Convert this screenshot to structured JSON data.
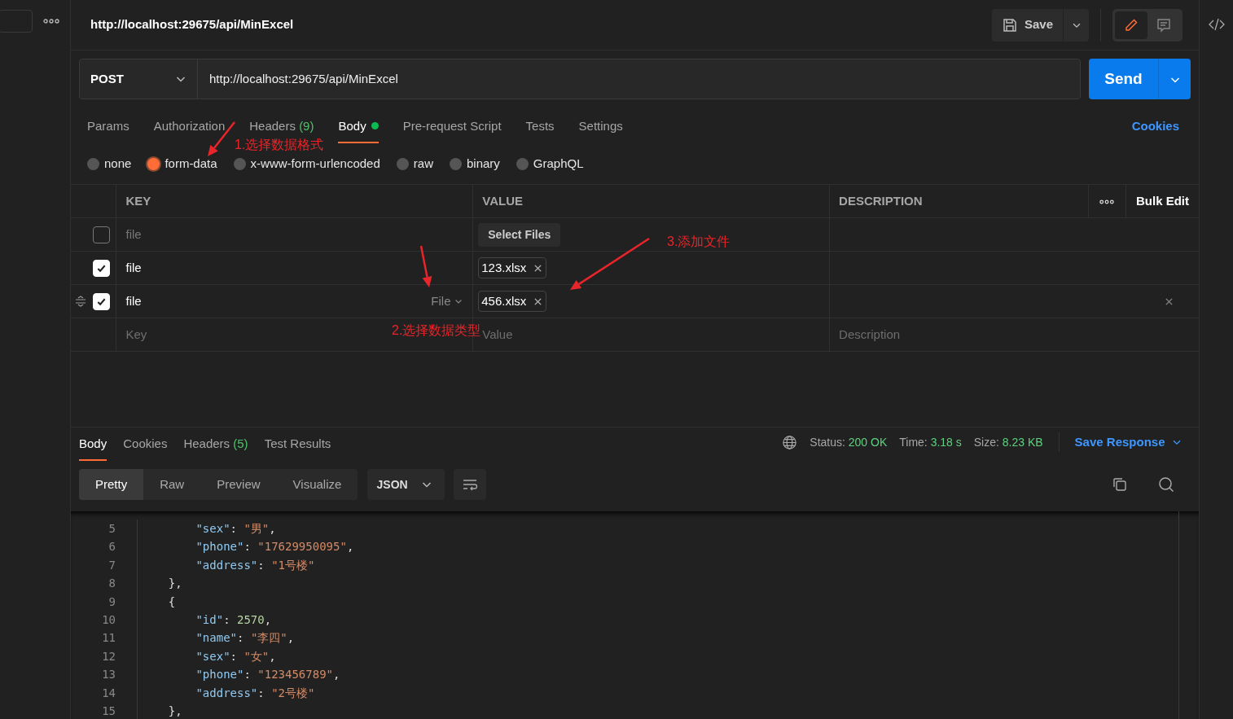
{
  "request_tab": {
    "title": "http://localhost:29675/api/MinExcel"
  },
  "save": {
    "label": "Save"
  },
  "mode_toggle": [
    {
      "kind": "edit",
      "selected": true
    },
    {
      "kind": "comment",
      "selected": false
    }
  ],
  "request": {
    "method": "POST",
    "url": "http://localhost:29675/api/MinExcel",
    "send": "Send"
  },
  "request_tabs": [
    {
      "label": "Params",
      "selected": false
    },
    {
      "label": "Authorization",
      "selected": false
    },
    {
      "label": "Headers",
      "count": "(9)",
      "selected": false
    },
    {
      "label": "Body",
      "selected": true,
      "indicator": true
    },
    {
      "label": "Pre-request Script",
      "selected": false
    },
    {
      "label": "Tests",
      "selected": false
    },
    {
      "label": "Settings",
      "selected": false
    }
  ],
  "cookies_link": "Cookies",
  "body_types": [
    {
      "label": "none",
      "selected": false
    },
    {
      "label": "form-data",
      "selected": true
    },
    {
      "label": "x-www-form-urlencoded",
      "selected": false
    },
    {
      "label": "raw",
      "selected": false
    },
    {
      "label": "binary",
      "selected": false
    },
    {
      "label": "GraphQL",
      "selected": false
    }
  ],
  "form_table": {
    "columns": [
      "KEY",
      "VALUE",
      "DESCRIPTION"
    ],
    "bulk_edit": "Bulk Edit",
    "rows": [
      {
        "checked": false,
        "key": "file",
        "kind": "button",
        "value": "Select Files",
        "hovered": false
      },
      {
        "checked": true,
        "key": "file",
        "kind": "chip",
        "value": "123.xlsx",
        "hovered": false
      },
      {
        "checked": true,
        "key": "file",
        "type": "File",
        "kind": "chip",
        "value": "456.xlsx",
        "hovered": true
      }
    ],
    "new_row": {
      "key": "Key",
      "value": "Value",
      "description": "Description"
    }
  },
  "annotations": [
    {
      "text": "1.选择数据格式"
    },
    {
      "text": "2.选择数据类型"
    },
    {
      "text": "3.添加文件"
    }
  ],
  "response": {
    "tabs": [
      {
        "label": "Body",
        "selected": true
      },
      {
        "label": "Cookies",
        "selected": false
      },
      {
        "label": "Headers",
        "count": "(5)",
        "selected": false
      },
      {
        "label": "Test Results",
        "selected": false
      }
    ],
    "stats": [
      {
        "label": "Status:",
        "value": "200 OK"
      },
      {
        "label": "Time:",
        "value": "3.18 s"
      },
      {
        "label": "Size:",
        "value": "8.23 KB"
      }
    ],
    "save_response": "Save Response",
    "views": [
      {
        "label": "Pretty",
        "selected": true
      },
      {
        "label": "Raw",
        "selected": false
      },
      {
        "label": "Preview",
        "selected": false
      },
      {
        "label": "Visualize",
        "selected": false
      }
    ],
    "format": "JSON",
    "code_lines": [
      {
        "number": "5",
        "tokens": [
          {
            "kind": "key",
            "text": "        \"sex\""
          },
          {
            "kind": "punct",
            "text": ": "
          },
          {
            "kind": "string",
            "text": "\"男\""
          },
          {
            "kind": "punct",
            "text": ","
          }
        ]
      },
      {
        "number": "6",
        "tokens": [
          {
            "kind": "key",
            "text": "        \"phone\""
          },
          {
            "kind": "punct",
            "text": ": "
          },
          {
            "kind": "string",
            "text": "\"17629950095\""
          },
          {
            "kind": "punct",
            "text": ","
          }
        ]
      },
      {
        "number": "7",
        "tokens": [
          {
            "kind": "key",
            "text": "        \"address\""
          },
          {
            "kind": "punct",
            "text": ": "
          },
          {
            "kind": "string",
            "text": "\"1号楼\""
          }
        ]
      },
      {
        "number": "8",
        "tokens": [
          {
            "kind": "punct",
            "text": "    },"
          }
        ]
      },
      {
        "number": "9",
        "tokens": [
          {
            "kind": "punct",
            "text": "    {"
          }
        ]
      },
      {
        "number": "10",
        "tokens": [
          {
            "kind": "key",
            "text": "        \"id\""
          },
          {
            "kind": "punct",
            "text": ": "
          },
          {
            "kind": "number",
            "text": "2570"
          },
          {
            "kind": "punct",
            "text": ","
          }
        ]
      },
      {
        "number": "11",
        "tokens": [
          {
            "kind": "key",
            "text": "        \"name\""
          },
          {
            "kind": "punct",
            "text": ": "
          },
          {
            "kind": "string",
            "text": "\"李四\""
          },
          {
            "kind": "punct",
            "text": ","
          }
        ]
      },
      {
        "number": "12",
        "tokens": [
          {
            "kind": "key",
            "text": "        \"sex\""
          },
          {
            "kind": "punct",
            "text": ": "
          },
          {
            "kind": "string",
            "text": "\"女\""
          },
          {
            "kind": "punct",
            "text": ","
          }
        ]
      },
      {
        "number": "13",
        "tokens": [
          {
            "kind": "key",
            "text": "        \"phone\""
          },
          {
            "kind": "punct",
            "text": ": "
          },
          {
            "kind": "string",
            "text": "\"123456789\""
          },
          {
            "kind": "punct",
            "text": ","
          }
        ]
      },
      {
        "number": "14",
        "tokens": [
          {
            "kind": "key",
            "text": "        \"address\""
          },
          {
            "kind": "punct",
            "text": ": "
          },
          {
            "kind": "string",
            "text": "\"2号楼\""
          }
        ]
      },
      {
        "number": "15",
        "tokens": [
          {
            "kind": "punct",
            "text": "    },"
          }
        ]
      }
    ]
  }
}
